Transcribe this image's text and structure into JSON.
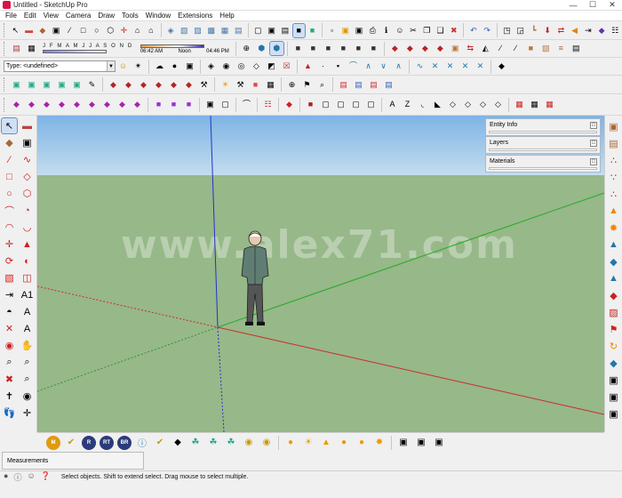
{
  "window": {
    "title": "Untitled - SketchUp Pro"
  },
  "menu": [
    "File",
    "Edit",
    "View",
    "Camera",
    "Draw",
    "Tools",
    "Window",
    "Extensions",
    "Help"
  ],
  "shadows": {
    "months": "J F M A M J J A S O N D",
    "time_start": "06:42 AM",
    "time_mid": "Noon",
    "time_end": "04:46 PM"
  },
  "type_field": {
    "value": "Type: <undefined>"
  },
  "trays": {
    "entity_info": "Entity Info",
    "layers": "Layers",
    "materials": "Materials"
  },
  "watermark": "www.alex71.com",
  "bottom_badges": {
    "m": "M",
    "r": "R",
    "rt": "RT",
    "br": "BR"
  },
  "measurements": {
    "label": "Measurements"
  },
  "status": {
    "text": "Select objects. Shift to extend select. Drag mouse to select multiple."
  },
  "axes_colors": {
    "red": "#cc2b2b",
    "green": "#22aa22",
    "blue": "#2233cc"
  },
  "toolbar_row1_icons": [
    "select-icon",
    "eraser-icon",
    "paint-icon",
    "make-component-icon",
    "home-icon",
    "rectangle-icon",
    "circle-icon",
    "undo-icon",
    "redo-icon",
    "push-pull-icon",
    "offset-icon",
    "move-icon",
    "rotate-icon",
    "scale-icon",
    "tape-icon",
    "dimension-icon",
    "protractor-icon",
    "text-icon",
    "axes-icon",
    "3d-text-icon"
  ]
}
